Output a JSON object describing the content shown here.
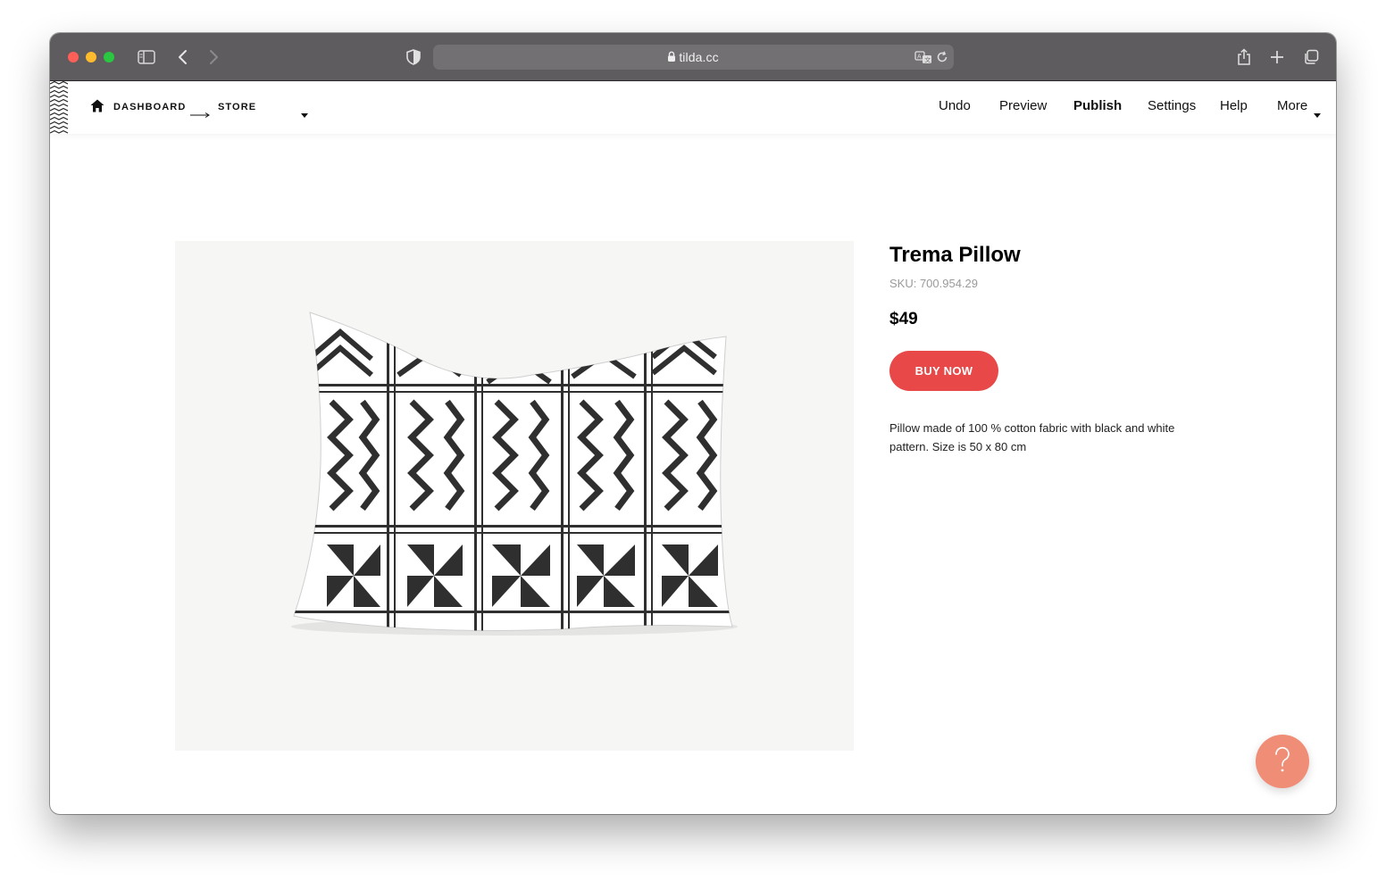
{
  "browser": {
    "url": "tilda.cc"
  },
  "nav": {
    "breadcrumb_dashboard": "DASHBOARD",
    "breadcrumb_store": "STORE",
    "undo": "Undo",
    "preview": "Preview",
    "publish": "Publish",
    "settings": "Settings",
    "help": "Help",
    "more": "More"
  },
  "product": {
    "title": "Trema Pillow",
    "sku": "SKU: 700.954.29",
    "price": "$49",
    "buy_label": "BUY NOW",
    "description": "Pillow made of 100 % cotton fabric with black and white pattern. Size is 50 x 80 cm",
    "pattern_colors": [
      "#2f2f2f",
      "#ffffff"
    ]
  },
  "colors": {
    "accent_button": "#e84848",
    "help_button": "#f08d76",
    "titlebar": "#5f5c5f"
  },
  "icons": {
    "help": "question-mark-icon"
  }
}
